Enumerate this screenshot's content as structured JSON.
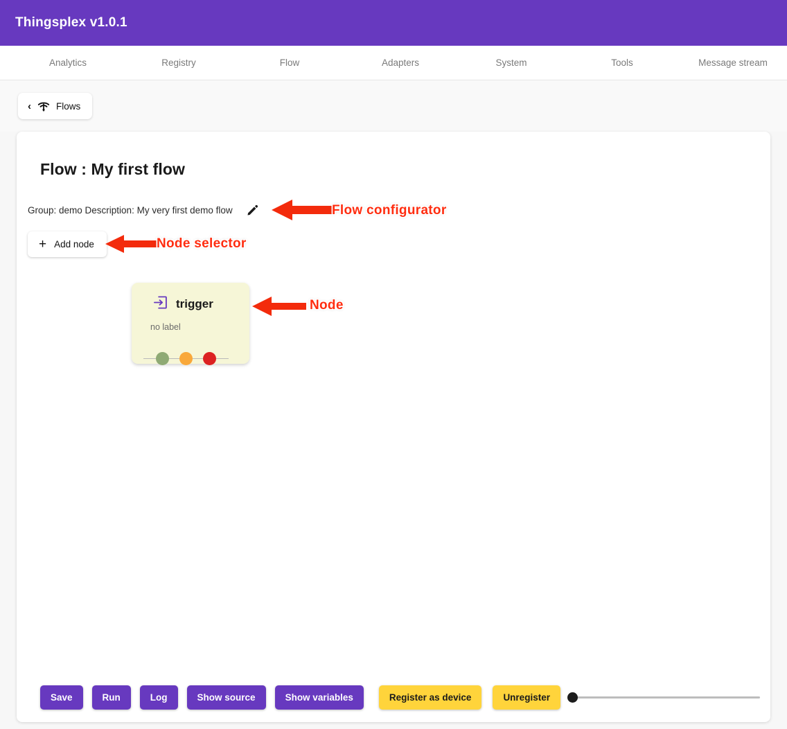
{
  "app": {
    "title": "Thingsplex v1.0.1",
    "brand_color": "#6739bf"
  },
  "nav": {
    "items": [
      {
        "label": "Analytics"
      },
      {
        "label": "Registry"
      },
      {
        "label": "Flow"
      },
      {
        "label": "Adapters"
      },
      {
        "label": "System"
      },
      {
        "label": "Tools"
      },
      {
        "label": "Message stream"
      }
    ]
  },
  "breadcrumb": {
    "back_chevron": "‹",
    "icon": "wifi-icon",
    "label": "Flows"
  },
  "flow": {
    "page_title": "Flow : My first flow",
    "meta_text": "Group: demo Description: My very first demo flow",
    "edit_icon": "pencil-icon",
    "add_node_label": "Add node",
    "add_node_icon": "plus-icon"
  },
  "node": {
    "icon": "login-icon",
    "title": "trigger",
    "subtitle": "no label",
    "card_color": "#f6f6d7",
    "ports": [
      {
        "name": "success-port",
        "color": "#8faa74"
      },
      {
        "name": "warning-port",
        "color": "#f9a83a"
      },
      {
        "name": "error-port",
        "color": "#dc2222"
      }
    ]
  },
  "annotations": [
    {
      "text": "Flow configurator",
      "color": "#ff2d10"
    },
    {
      "text": "Node selector",
      "color": "#ff2d10"
    },
    {
      "text": "Node",
      "color": "#ff2d10"
    }
  ],
  "actions": {
    "buttons": [
      {
        "label": "Save",
        "style": "purple"
      },
      {
        "label": "Run",
        "style": "purple"
      },
      {
        "label": "Log",
        "style": "purple"
      },
      {
        "label": "Show source",
        "style": "purple"
      },
      {
        "label": "Show variables",
        "style": "purple"
      },
      {
        "label": "Register as device",
        "style": "yellow"
      },
      {
        "label": "Unregister",
        "style": "yellow"
      }
    ],
    "slider": {
      "name": "zoom-slider",
      "value": 0
    }
  }
}
